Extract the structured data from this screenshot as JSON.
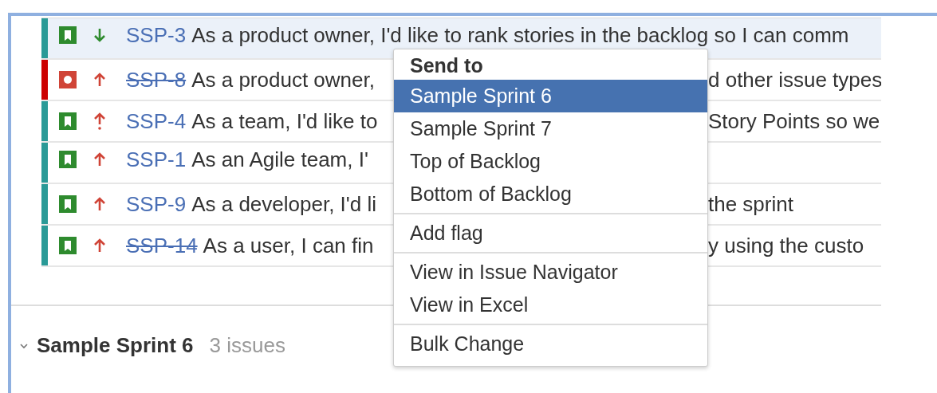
{
  "issues": [
    {
      "kind": "story",
      "color": "#2a9a97",
      "selected": true,
      "priority": {
        "kind": "low"
      },
      "key": "SSP-3",
      "done": false,
      "summary_left": "As a product owner, I'd like to rank stories in the backlog so I can comm"
    },
    {
      "kind": "bug",
      "color": "#cc0000",
      "selected": false,
      "priority": {
        "kind": "high"
      },
      "key": "SSP-8",
      "done": true,
      "summary_left": "As a product owner,",
      "summary_right": "d other issue types"
    },
    {
      "kind": "story",
      "color": "#2a9a97",
      "selected": false,
      "priority": {
        "kind": "highest"
      },
      "key": "SSP-4",
      "done": false,
      "summary_left": "As a team, I'd like to",
      "summary_right": "Story Points so we"
    },
    {
      "kind": "story",
      "color": "#2a9a97",
      "selected": false,
      "priority": {
        "kind": "high"
      },
      "key": "SSP-1",
      "done": false,
      "summary_left": "As an Agile team, I'"
    },
    {
      "kind": "story",
      "color": "#2a9a97",
      "selected": false,
      "priority": {
        "kind": "high"
      },
      "key": "SSP-9",
      "done": false,
      "summary_left": "As a developer, I'd li",
      "summary_right": "the sprint"
    },
    {
      "kind": "story",
      "color": "#2a9a97",
      "selected": false,
      "priority": {
        "kind": "high"
      },
      "key": "SSP-14",
      "done": true,
      "summary_left": "As a user, I can fin",
      "summary_right": "y using the custo"
    }
  ],
  "sprint": {
    "expanded": true,
    "title": "Sample Sprint 6",
    "count": "3 issues"
  },
  "context_menu": {
    "sections": [
      {
        "heading": "Send to",
        "items": [
          {
            "label": "Sample Sprint 6",
            "selected": true
          },
          {
            "label": "Sample Sprint 7",
            "selected": false
          },
          {
            "label": "Top of Backlog",
            "selected": false
          },
          {
            "label": "Bottom of Backlog",
            "selected": false
          }
        ]
      },
      {
        "items": [
          {
            "label": "Add flag",
            "selected": false
          }
        ]
      },
      {
        "items": [
          {
            "label": "View in Issue Navigator",
            "selected": false
          },
          {
            "label": "View in Excel",
            "selected": false
          }
        ]
      },
      {
        "items": [
          {
            "label": "Bulk Change",
            "selected": false
          }
        ]
      }
    ]
  }
}
